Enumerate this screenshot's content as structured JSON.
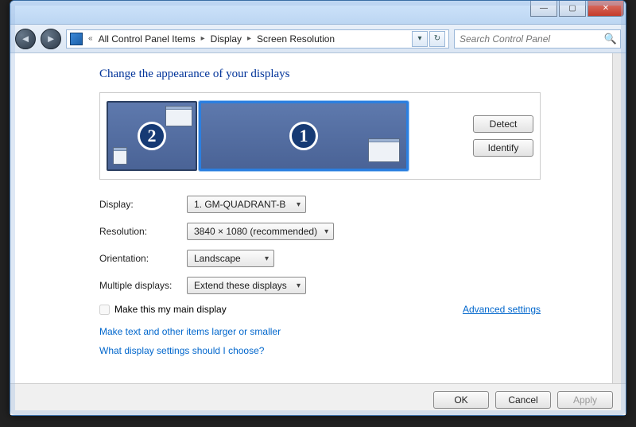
{
  "titlebar": {
    "min": "—",
    "max": "▢",
    "close": "✕"
  },
  "addressbar": {
    "back_glyph": "◄",
    "fwd_glyph": "►",
    "chevron_left": "«",
    "crumbs": [
      "All Control Panel Items",
      "Display",
      "Screen Resolution"
    ],
    "dropdown_glyph": "▾",
    "refresh_glyph": "↻",
    "search_placeholder": "Search Control Panel"
  },
  "heading": "Change the appearance of your displays",
  "arrange": {
    "monitor_secondary_number": "2",
    "monitor_primary_number": "1",
    "detect_label": "Detect",
    "identify_label": "Identify"
  },
  "form": {
    "display_label": "Display:",
    "display_value": "1. GM-QUADRANT-B",
    "resolution_label": "Resolution:",
    "resolution_value": "3840 × 1080 (recommended)",
    "orientation_label": "Orientation:",
    "orientation_value": "Landscape",
    "multiple_label": "Multiple displays:",
    "multiple_value": "Extend these displays",
    "main_display_label": "Make this my main display",
    "advanced_link": "Advanced settings",
    "link_textsize": "Make text and other items larger or smaller",
    "link_help": "What display settings should I choose?"
  },
  "buttonbar": {
    "ok": "OK",
    "cancel": "Cancel",
    "apply": "Apply"
  }
}
